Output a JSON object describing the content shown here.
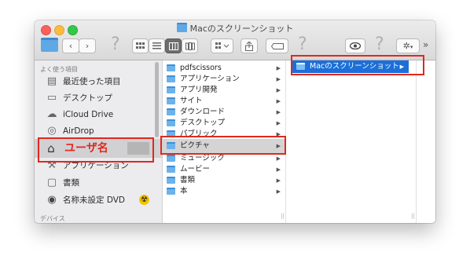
{
  "window": {
    "title": "Macのスクリーンショット"
  },
  "toolbar": {
    "back": "‹",
    "forward": "›",
    "help": "?",
    "view_icon": "icon-view",
    "view_list": "list-view",
    "view_column": "column-view",
    "view_cover": "coverflow-view",
    "more": "»"
  },
  "sidebar": {
    "favorites_heading": "よく使う項目",
    "devices_heading": "デバイス",
    "items": [
      {
        "label": "最近使った項目",
        "icon": "recents-icon"
      },
      {
        "label": "デスクトップ",
        "icon": "desktop-icon"
      },
      {
        "label": "iCloud Drive",
        "icon": "cloud-icon"
      },
      {
        "label": "AirDrop",
        "icon": "airdrop-icon"
      },
      {
        "label": "ユーザ名",
        "icon": "home-icon"
      },
      {
        "label": "アプリケーション",
        "icon": "applications-icon"
      },
      {
        "label": "書類",
        "icon": "documents-icon"
      },
      {
        "label": "名称未設定 DVD",
        "icon": "dvd-icon"
      }
    ]
  },
  "column1": {
    "items": [
      {
        "label": "pdfscissors",
        "kind": "folder"
      },
      {
        "label": "アプリケーション",
        "kind": "folder"
      },
      {
        "label": "アプリ開発",
        "kind": "folder"
      },
      {
        "label": "サイト",
        "kind": "folder"
      },
      {
        "label": "ダウンロード",
        "kind": "folder"
      },
      {
        "label": "デスクトップ",
        "kind": "folder"
      },
      {
        "label": "パブリック",
        "kind": "folder"
      },
      {
        "label": "ピクチャ",
        "kind": "folder"
      },
      {
        "label": "ミュージック",
        "kind": "folder"
      },
      {
        "label": "ムービー",
        "kind": "folder"
      },
      {
        "label": "書類",
        "kind": "folder"
      },
      {
        "label": "本",
        "kind": "folder"
      }
    ]
  },
  "column2": {
    "items": [
      {
        "label": "Macのスクリーンショット",
        "kind": "folder"
      }
    ]
  },
  "colors": {
    "selection_blue": "#1c6fd9",
    "selection_gray": "#d4d4d4",
    "highlight_red": "#e0281e",
    "sidebar_bg": "#ececef"
  }
}
